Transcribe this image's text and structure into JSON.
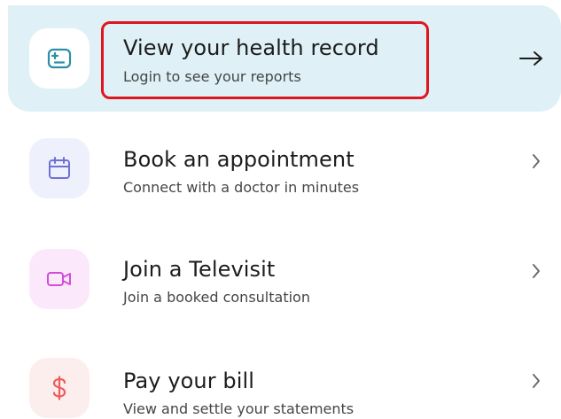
{
  "items": [
    {
      "title": "View your health record",
      "subtitle": "Login to see your reports",
      "icon": "health-record-icon",
      "accent": "#2c8fa6",
      "tile_bg": "#ffffff",
      "active": true
    },
    {
      "title": "Book an appointment",
      "subtitle": "Connect with a doctor in minutes",
      "icon": "calendar-icon",
      "accent": "#6f6fd8",
      "tile_bg": "#eef0fb",
      "active": false
    },
    {
      "title": "Join a Televisit",
      "subtitle": "Join a booked consultation",
      "icon": "video-camera-icon",
      "accent": "#d04fd6",
      "tile_bg": "#fbe9fb",
      "active": false
    },
    {
      "title": "Pay your bill",
      "subtitle": "View and settle your statements",
      "icon": "dollar-icon",
      "accent": "#ef5c5c",
      "tile_bg": "#fdeeee",
      "active": false
    }
  ],
  "colors": {
    "active_bg": "#dff1f6",
    "highlight": "#e0161f",
    "chevron": "#6b6b6b"
  }
}
